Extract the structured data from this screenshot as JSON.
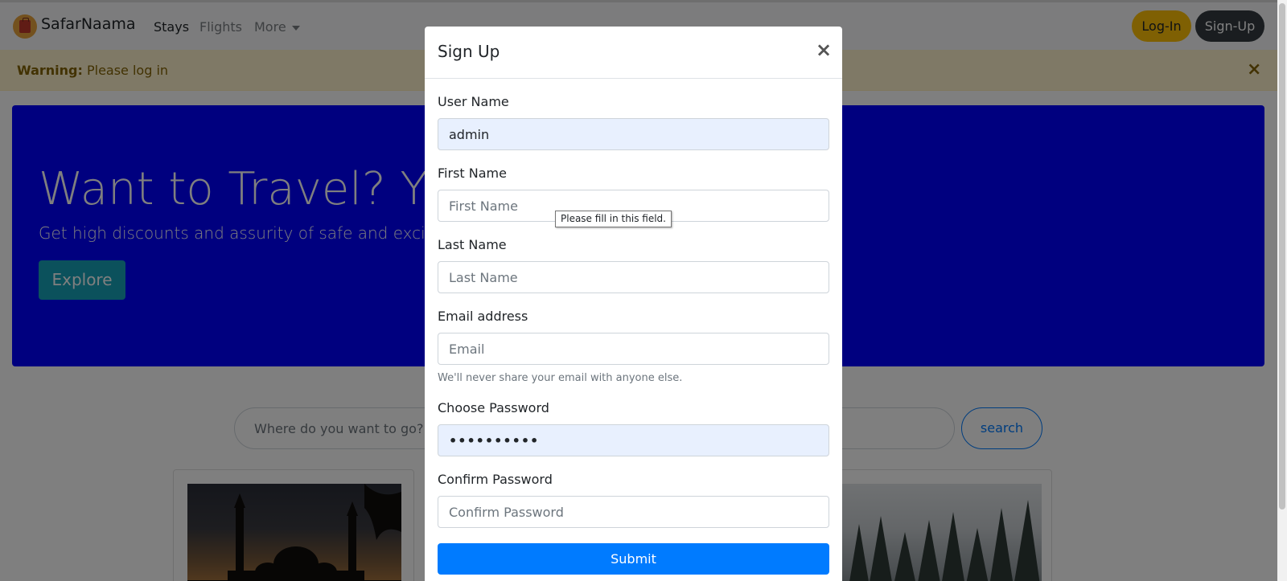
{
  "navbar": {
    "brand": "SafarNaama",
    "links": [
      {
        "label": "Stays"
      },
      {
        "label": "Flights"
      },
      {
        "label": "More"
      }
    ],
    "login_label": "Log-In",
    "signup_label": "Sign-Up"
  },
  "alert": {
    "strong": "Warning:",
    "message": " Please log in",
    "close": "×"
  },
  "jumbotron": {
    "title": "Want to Travel? Yo",
    "lead": "Get high discounts and assurity of safe and excited t",
    "button_label": "Explore"
  },
  "search": {
    "placeholder": "Where do you want to go?",
    "button_label": "search"
  },
  "modal": {
    "title": "Sign Up",
    "close": "×",
    "fields": [
      {
        "label": "User Name",
        "value": "admin",
        "placeholder": ""
      },
      {
        "label": "First Name",
        "value": "",
        "placeholder": "First Name"
      },
      {
        "label": "Last Name",
        "value": "",
        "placeholder": "Last Name"
      },
      {
        "label": "Email address",
        "value": "",
        "placeholder": "Email"
      },
      {
        "label": "Choose Password",
        "value": "••••••••••",
        "placeholder": ""
      },
      {
        "label": "Confirm Password",
        "value": "",
        "placeholder": "Confirm Password"
      }
    ],
    "email_help": "We'll never share your email with anyone else.",
    "tooltip": "Please fill in this field.",
    "submit_label": "Submit"
  },
  "colors": {
    "jumbotron_bg": "#0000ff",
    "primary": "#007bff",
    "warning": "#ffc107",
    "dark": "#343a40",
    "info": "#17a2b8",
    "alert_bg": "#fff3cd"
  }
}
